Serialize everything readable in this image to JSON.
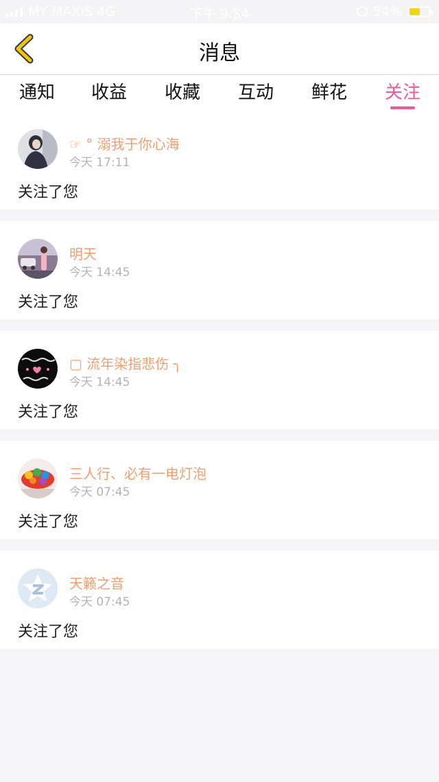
{
  "status_bar": {
    "carrier": "MY MAXIS 4G",
    "time": "下午 9:54",
    "battery": "54%",
    "battery_level": 0.54,
    "battery_color": "#f5d60b"
  },
  "header": {
    "title": "消息",
    "back_icon": "chevron-left-icon",
    "back_color": "#f0c40a"
  },
  "tabs": [
    {
      "label": "通知",
      "active": false
    },
    {
      "label": "收益",
      "active": false
    },
    {
      "label": "收藏",
      "active": false
    },
    {
      "label": "互动",
      "active": false
    },
    {
      "label": "鲜花",
      "active": false
    },
    {
      "label": "关注",
      "active": true
    }
  ],
  "accent_color": "#ec5a97",
  "name_color": "#f0a070",
  "notifications": [
    {
      "name": "☞ ° 溺我于你心海",
      "time": "今天 17:11",
      "message": "关注了您"
    },
    {
      "name": "明天",
      "time": "今天 14:45",
      "message": "关注了您"
    },
    {
      "name": "▢ 流年染指悲伤 ╮",
      "time": "今天 14:45",
      "message": "关注了您"
    },
    {
      "name": "三人行、必有一电灯泡",
      "time": "今天 07:45",
      "message": "关注了您"
    },
    {
      "name": "天籁之音",
      "time": "今天 07:45",
      "message": "关注了您"
    }
  ]
}
